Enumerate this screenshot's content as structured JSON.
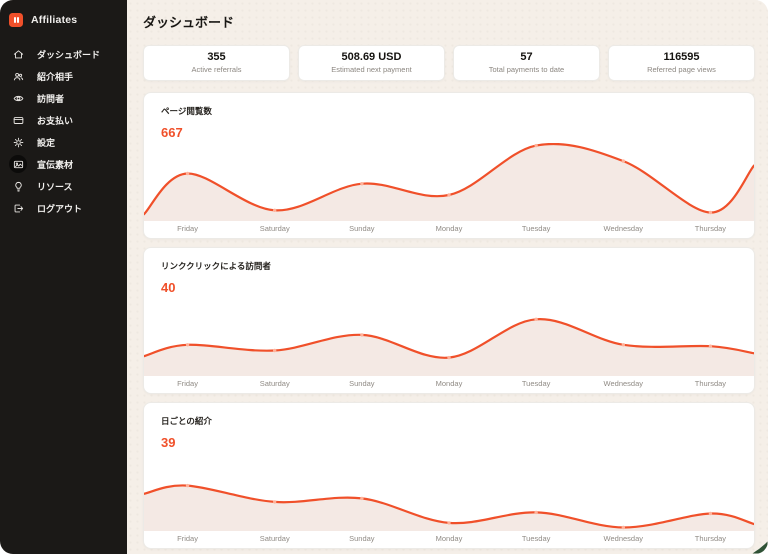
{
  "app": {
    "name": "Affiliates"
  },
  "sidebar": {
    "items": [
      {
        "label": "ダッシュボード",
        "icon": "home",
        "highlighted": false
      },
      {
        "label": "紹介相手",
        "icon": "users",
        "highlighted": false
      },
      {
        "label": "訪問者",
        "icon": "eye",
        "highlighted": false
      },
      {
        "label": "お支払い",
        "icon": "card",
        "highlighted": false
      },
      {
        "label": "設定",
        "icon": "gear",
        "highlighted": false
      },
      {
        "label": "宣伝素材",
        "icon": "media",
        "highlighted": true
      },
      {
        "label": "リソース",
        "icon": "lightbulb",
        "highlighted": false
      },
      {
        "label": "ログアウト",
        "icon": "logout",
        "highlighted": false
      }
    ]
  },
  "header": {
    "title": "ダッシュボード"
  },
  "stats": [
    {
      "value": "355",
      "label": "Active referrals"
    },
    {
      "value": "508.69 USD",
      "label": "Estimated next payment"
    },
    {
      "value": "57",
      "label": "Total payments to date"
    },
    {
      "value": "116595",
      "label": "Referred page views"
    }
  ],
  "colors": {
    "accent": "#f0502a",
    "marker": "#ffb29a",
    "area_fill": "#f4e9e4",
    "sidebar_bg": "#1b1917",
    "page_bg": "#f5efe8",
    "cursor_green": "#2f5236"
  },
  "chart_data": [
    {
      "type": "area",
      "title": "ページ閲覧数",
      "current_value": "667",
      "categories": [
        "Friday",
        "Saturday",
        "Sunday",
        "Monday",
        "Tuesday",
        "Wednesday",
        "Thursday"
      ],
      "values": [
        420,
        95,
        330,
        230,
        667,
        530,
        75
      ],
      "edge_start": 60,
      "edge_end": 490,
      "ylim": [
        0,
        690
      ],
      "line_color": "#f0502a",
      "legend": "none",
      "grid": false
    },
    {
      "type": "area",
      "title": "リンククリックによる訪問者",
      "current_value": "40",
      "categories": [
        "Friday",
        "Saturday",
        "Sunday",
        "Monday",
        "Tuesday",
        "Wednesday",
        "Thursday"
      ],
      "values": [
        22,
        18,
        29,
        13,
        40,
        22,
        21
      ],
      "edge_start": 14,
      "edge_end": 16,
      "ylim": [
        0,
        55
      ],
      "line_color": "#f0502a",
      "legend": "none",
      "grid": false
    },
    {
      "type": "area",
      "title": "日ごとの紹介",
      "current_value": "39",
      "categories": [
        "Friday",
        "Saturday",
        "Sunday",
        "Monday",
        "Tuesday",
        "Wednesday",
        "Thursday"
      ],
      "values": [
        39,
        25,
        28,
        7,
        16,
        3,
        15
      ],
      "edge_start": 32,
      "edge_end": 6,
      "ylim": [
        0,
        67
      ],
      "line_color": "#f0502a",
      "legend": "none",
      "grid": false
    }
  ]
}
